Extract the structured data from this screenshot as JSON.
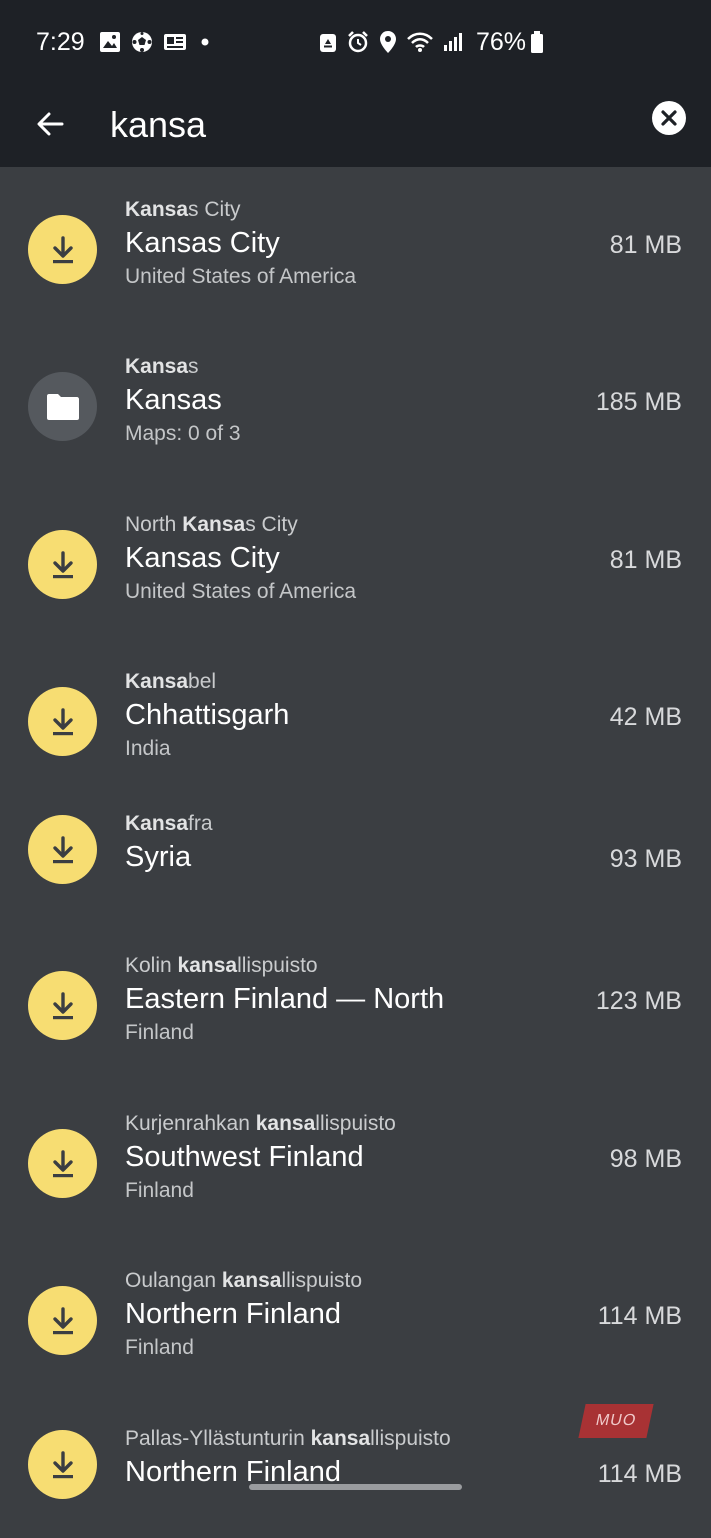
{
  "status_bar": {
    "time": "7:29",
    "battery": "76%",
    "icons_left": [
      "image-icon",
      "soccer-ball-icon",
      "news-icon",
      "dot-icon"
    ],
    "icons_right": [
      "recycle-icon",
      "alarm-icon",
      "location-icon",
      "wifi-icon",
      "signal-icon",
      "battery-icon"
    ]
  },
  "search": {
    "query": "kansa",
    "back_icon": "arrow-left-icon",
    "clear_icon": "close-circle-icon"
  },
  "results": [
    {
      "icon": "download",
      "match_pre": "",
      "match_bold": "Kansa",
      "match_post": "s City",
      "title": "Kansas City",
      "subtitle": "United States of America",
      "size": "81 MB"
    },
    {
      "icon": "folder",
      "match_pre": "",
      "match_bold": "Kansa",
      "match_post": "s",
      "title": "Kansas",
      "subtitle": "Maps: 0 of 3",
      "size": "185 MB"
    },
    {
      "icon": "download",
      "match_pre": "North ",
      "match_bold": "Kansa",
      "match_post": "s City",
      "title": "Kansas City",
      "subtitle": "United States of America",
      "size": "81 MB"
    },
    {
      "icon": "download",
      "match_pre": "",
      "match_bold": "Kansa",
      "match_post": "bel",
      "title": "Chhattisgarh",
      "subtitle": "India",
      "size": "42 MB"
    },
    {
      "icon": "download",
      "match_pre": "",
      "match_bold": "Kansa",
      "match_post": "fra",
      "title": "Syria",
      "subtitle": "",
      "size": "93 MB"
    },
    {
      "icon": "download",
      "match_pre": "Kolin ",
      "match_bold": "kansa",
      "match_post": "llispuisto",
      "title": "Eastern Finland — North",
      "subtitle": "Finland",
      "size": "123 MB"
    },
    {
      "icon": "download",
      "match_pre": "Kurjenrahkan ",
      "match_bold": "kansa",
      "match_post": "llispuisto",
      "title": "Southwest Finland",
      "subtitle": "Finland",
      "size": "98 MB"
    },
    {
      "icon": "download",
      "match_pre": "Oulangan ",
      "match_bold": "kansa",
      "match_post": "llispuisto",
      "title": "Northern Finland",
      "subtitle": "Finland",
      "size": "114 MB"
    },
    {
      "icon": "download",
      "match_pre": "Pallas-Yllästunturin ",
      "match_bold": "kansa",
      "match_post": "llispuisto",
      "title": "Northern Finland",
      "subtitle": "",
      "size": "114 MB"
    }
  ],
  "watermark": "MUO",
  "colors": {
    "background": "#3b3e42",
    "toolbar": "#1e2126",
    "download_accent": "#f7dd72",
    "folder_bg": "#55595e"
  }
}
